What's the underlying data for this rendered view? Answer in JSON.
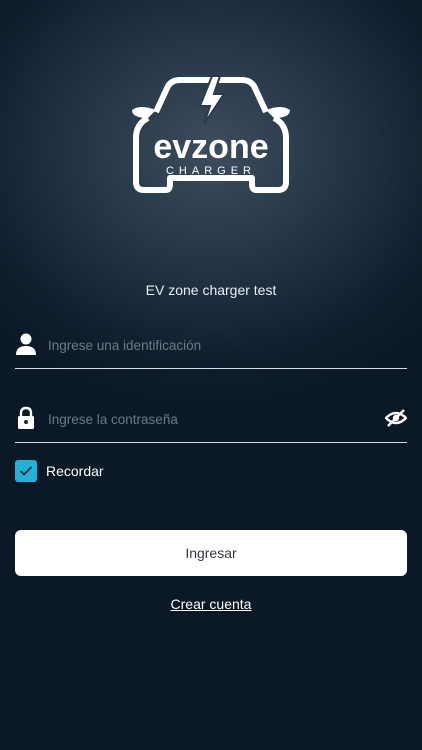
{
  "brand": {
    "logo_word": "evzone",
    "logo_sub": "CHARGER",
    "app_name": "EV zone charger test"
  },
  "form": {
    "username": {
      "placeholder": "Ingrese una identificación",
      "value": "",
      "icon": "user-icon"
    },
    "password": {
      "placeholder": "Ingrese la contraseña",
      "value": "",
      "icon": "lock-icon",
      "toggle_icon": "eye-off-icon"
    },
    "remember": {
      "label": "Recordar",
      "checked": true
    }
  },
  "actions": {
    "login_label": "Ingresar",
    "create_account_label": "Crear cuenta"
  },
  "colors": {
    "background": "#0b1a28",
    "accent": "#1fb3d9",
    "button_bg": "#ffffff",
    "button_text": "#333840"
  }
}
